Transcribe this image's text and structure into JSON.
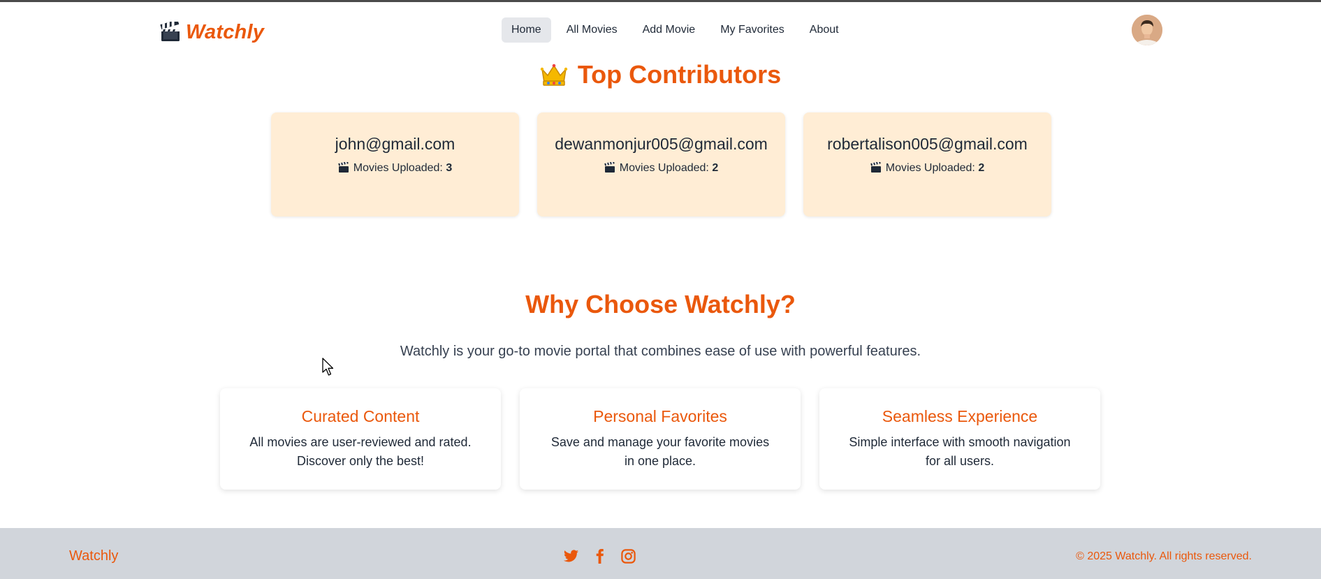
{
  "brand": {
    "name": "Watchly",
    "accent_color": "#ea580c",
    "logo_icon": "clapperboard-icon"
  },
  "nav": {
    "items": [
      {
        "label": "Home",
        "active": true
      },
      {
        "label": "All Movies",
        "active": false
      },
      {
        "label": "Add Movie",
        "active": false
      },
      {
        "label": "My Favorites",
        "active": false
      },
      {
        "label": "About",
        "active": false
      }
    ],
    "avatar_icon": "user-avatar"
  },
  "top_contributors": {
    "title": "Top Contributors",
    "title_icon": "crown-icon",
    "count_label": "Movies Uploaded:",
    "cards": [
      {
        "email": "john@gmail.com",
        "count": "3"
      },
      {
        "email": "dewanmonjur005@gmail.com",
        "count": "2"
      },
      {
        "email": "robertalison005@gmail.com",
        "count": "2"
      }
    ],
    "card_bg": "#ffedd5"
  },
  "why": {
    "title": "Why Choose Watchly?",
    "subtitle": "Watchly is your go-to movie portal that combines ease of use with powerful features.",
    "features": [
      {
        "title": "Curated Content",
        "desc": "All movies are user-reviewed and rated. Discover only the best!"
      },
      {
        "title": "Personal Favorites",
        "desc": "Save and manage your favorite movies in one place."
      },
      {
        "title": "Seamless Experience",
        "desc": "Simple interface with smooth navigation for all users."
      }
    ]
  },
  "footer": {
    "brand": "Watchly",
    "socials": [
      "twitter-icon",
      "facebook-icon",
      "instagram-icon"
    ],
    "copyright": "© 2025 Watchly. All rights reserved.",
    "bg": "#d1d5db"
  }
}
